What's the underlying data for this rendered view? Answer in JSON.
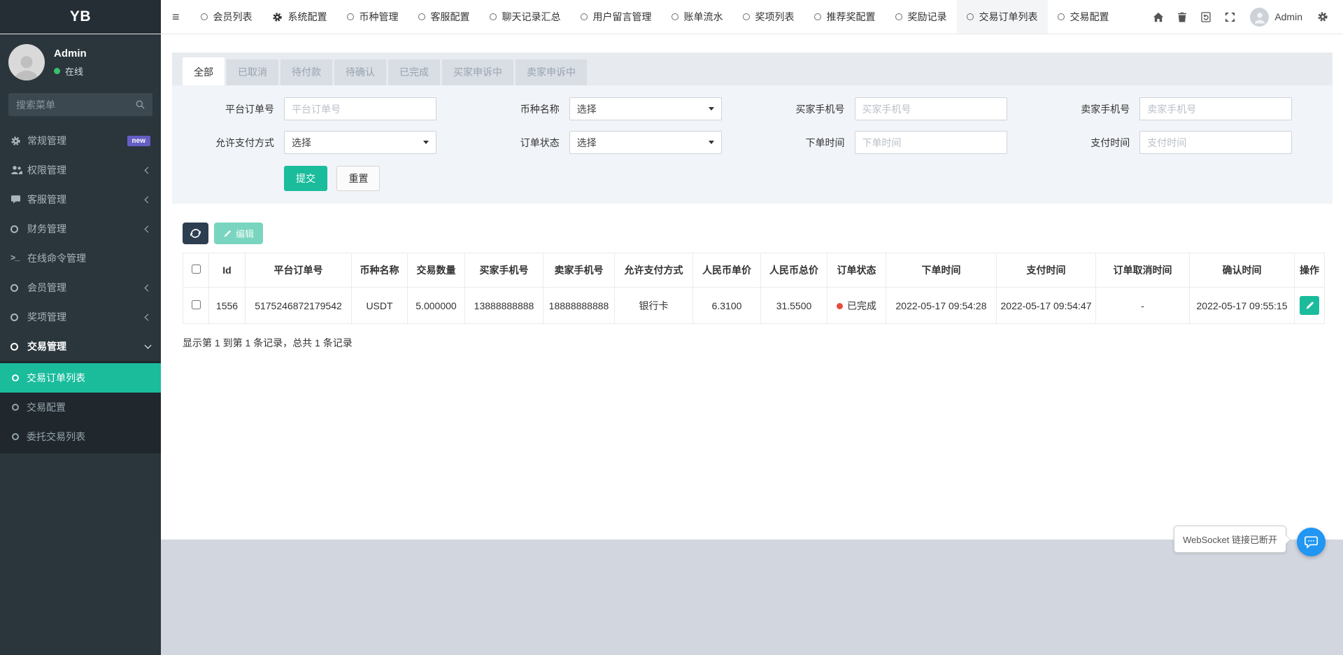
{
  "colors": {
    "accent": "#1abc9c",
    "sidebar_bg": "#2b353c",
    "submenu_bg": "#20282e",
    "logo_bg": "#252e34",
    "toolbar_navy": "#2c3e50",
    "status_red": "#e74c3c",
    "badge_purple": "#655ec4",
    "chat_blue": "#2196f3",
    "online_green": "#36c16a",
    "page_gray": "#d2d6de"
  },
  "navbar": {
    "logo": "YB",
    "items": [
      {
        "label": "会员列表",
        "icon": "circle-icon",
        "active": false
      },
      {
        "label": "系统配置",
        "icon": "gear-icon",
        "active": false
      },
      {
        "label": "币种管理",
        "icon": "circle-icon",
        "active": false
      },
      {
        "label": "客服配置",
        "icon": "circle-icon",
        "active": false
      },
      {
        "label": "聊天记录汇总",
        "icon": "circle-icon",
        "active": false
      },
      {
        "label": "用户留言管理",
        "icon": "circle-icon",
        "active": false
      },
      {
        "label": "账单流水",
        "icon": "circle-icon",
        "active": false
      },
      {
        "label": "奖项列表",
        "icon": "circle-icon",
        "active": false
      },
      {
        "label": "推荐奖配置",
        "icon": "circle-icon",
        "active": false
      },
      {
        "label": "奖励记录",
        "icon": "circle-icon",
        "active": false
      },
      {
        "label": "交易订单列表",
        "icon": "circle-icon",
        "active": true
      },
      {
        "label": "交易配置",
        "icon": "circle-icon",
        "active": false
      }
    ],
    "right_icons": [
      "home-icon",
      "trash-icon",
      "refresh-page-icon",
      "fullscreen-icon",
      "cogs-icon"
    ],
    "admin_label": "Admin"
  },
  "sidebar": {
    "user": {
      "name": "Admin",
      "status": "在线"
    },
    "search_placeholder": "搜索菜单",
    "items": [
      {
        "label": "常规管理",
        "icon": "cogs-icon",
        "badge": "new"
      },
      {
        "label": "权限管理",
        "icon": "users-icon",
        "chevron": "left"
      },
      {
        "label": "客服管理",
        "icon": "chat-icon",
        "chevron": "left"
      },
      {
        "label": "财务管理",
        "icon": "circle-icon",
        "chevron": "left"
      },
      {
        "label": "在线命令管理",
        "icon": "terminal-icon"
      },
      {
        "label": "会员管理",
        "icon": "circle-icon",
        "chevron": "left"
      },
      {
        "label": "奖项管理",
        "icon": "circle-icon",
        "chevron": "left"
      },
      {
        "label": "交易管理",
        "icon": "circle-icon",
        "chevron": "down",
        "expanded": true
      }
    ],
    "submenu": [
      {
        "label": "交易订单列表",
        "active": true
      },
      {
        "label": "交易配置",
        "active": false
      },
      {
        "label": "委托交易列表",
        "active": false
      }
    ]
  },
  "tabs": {
    "items": [
      "全部",
      "已取消",
      "待付款",
      "待确认",
      "已完成",
      "买家申诉中",
      "卖家申诉中"
    ],
    "active_index": 0
  },
  "filters": {
    "fields": [
      {
        "key": "platform-order-no",
        "label": "平台订单号",
        "type": "input",
        "placeholder": "平台订单号"
      },
      {
        "key": "coin-name",
        "label": "币种名称",
        "type": "select",
        "value": "选择"
      },
      {
        "key": "buyer-phone",
        "label": "买家手机号",
        "type": "input",
        "placeholder": "买家手机号"
      },
      {
        "key": "seller-phone",
        "label": "卖家手机号",
        "type": "input",
        "placeholder": "卖家手机号"
      },
      {
        "key": "pay-method",
        "label": "允许支付方式",
        "type": "select",
        "value": "选择"
      },
      {
        "key": "order-status",
        "label": "订单状态",
        "type": "select",
        "value": "选择"
      },
      {
        "key": "order-time",
        "label": "下单时间",
        "type": "input",
        "placeholder": "下单时间"
      },
      {
        "key": "pay-time",
        "label": "支付时间",
        "type": "input",
        "placeholder": "支付时间"
      }
    ],
    "submit_label": "提交",
    "reset_label": "重置"
  },
  "toolbar": {
    "refresh_icon": "refresh-icon",
    "edit_label": "编辑"
  },
  "table": {
    "columns": [
      "Id",
      "平台订单号",
      "币种名称",
      "交易数量",
      "买家手机号",
      "卖家手机号",
      "允许支付方式",
      "人民币单价",
      "人民币总价",
      "订单状态",
      "下单时间",
      "支付时间",
      "订单取消时间",
      "确认时间",
      "操作"
    ],
    "rows": [
      {
        "id": "1556",
        "platform_order_no": "5175246872179542",
        "coin_name": "USDT",
        "trade_amount": "5.000000",
        "buyer_phone": "13888888888",
        "seller_phone": "18888888888",
        "pay_method": "银行卡",
        "cny_unit_price": "6.3100",
        "cny_total_price": "31.5500",
        "status": "已完成",
        "order_time": "2022-05-17 09:54:28",
        "pay_time": "2022-05-17 09:54:47",
        "cancel_time": "-",
        "confirm_time": "2022-05-17 09:55:15"
      }
    ],
    "summary": "显示第 1 到第 1 条记录，总共 1 条记录"
  },
  "chat_widget": {
    "tooltip": "WebSocket 链接已断开",
    "icon": "chat-bubble-icon"
  }
}
